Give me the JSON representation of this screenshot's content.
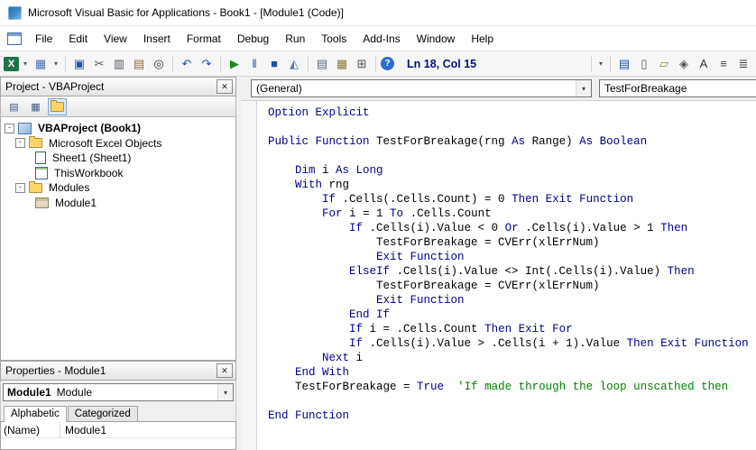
{
  "window": {
    "title": "Microsoft Visual Basic for Applications - Book1 - [Module1 (Code)]"
  },
  "icons": {
    "close": "✕",
    "dropdown": "▾"
  },
  "menu": {
    "items": [
      "File",
      "Edit",
      "View",
      "Insert",
      "Format",
      "Debug",
      "Run",
      "Tools",
      "Add-Ins",
      "Window",
      "Help"
    ]
  },
  "toolbar": {
    "items": [
      {
        "name": "view-microsoft-excel-icon",
        "glyph": "X",
        "style": "excel"
      },
      {
        "name": "view-excel-dropdown-icon",
        "glyph": "▾",
        "style": "arrow"
      },
      {
        "name": "insert-userform-icon",
        "glyph": "▦",
        "color": "#4a6fb5"
      },
      {
        "name": "insert-dropdown-icon",
        "glyph": "▾",
        "style": "arrow"
      },
      {
        "sep": true
      },
      {
        "name": "save-icon",
        "glyph": "▣",
        "color": "#2456a4"
      },
      {
        "name": "cut-icon",
        "glyph": "✂",
        "color": "#555555"
      },
      {
        "name": "copy-icon",
        "glyph": "▥",
        "color": "#556"
      },
      {
        "name": "paste-icon",
        "glyph": "▤",
        "color": "#8a6a3a"
      },
      {
        "name": "find-icon",
        "glyph": "◎",
        "color": "#333333"
      },
      {
        "sep": true
      },
      {
        "name": "undo-icon",
        "glyph": "↶",
        "color": "#1b4fae"
      },
      {
        "name": "redo-icon",
        "glyph": "↷",
        "color": "#1b4fae"
      },
      {
        "sep": true
      },
      {
        "name": "run-icon",
        "glyph": "▶",
        "color": "#1e8a1e"
      },
      {
        "name": "break-icon",
        "glyph": "‖",
        "color": "#1b4fae"
      },
      {
        "name": "reset-icon",
        "glyph": "■",
        "color": "#1b4fae"
      },
      {
        "name": "design-mode-icon",
        "glyph": "◭",
        "color": "#4a7ab5"
      },
      {
        "sep": true
      },
      {
        "name": "project-explorer-icon",
        "glyph": "▤",
        "color": "#5a6a8a"
      },
      {
        "name": "properties-window-icon",
        "glyph": "▦",
        "color": "#8a7a3a"
      },
      {
        "name": "object-browser-icon",
        "glyph": "⊞",
        "color": "#555555"
      },
      {
        "sep": true
      },
      {
        "name": "help-icon",
        "glyph": "?",
        "style": "help"
      },
      {
        "name": "cursor-position",
        "text": "Ln 18, Col 15"
      },
      {
        "spacer": true
      },
      {
        "sep": true
      },
      {
        "name": "toolbar-options-icon",
        "glyph": "▾",
        "style": "arrow"
      },
      {
        "sep": true
      },
      {
        "name": "list-properties-icon",
        "glyph": "▤",
        "color": "#1b4fae"
      },
      {
        "name": "list-constants-icon",
        "glyph": "▯",
        "color": "#555555"
      },
      {
        "name": "quick-info-icon",
        "glyph": "▱",
        "color": "#8a8a33"
      },
      {
        "name": "parameter-info-icon",
        "glyph": "◈",
        "color": "#555555"
      },
      {
        "name": "complete-word-icon",
        "glyph": "A",
        "color": "#333333"
      },
      {
        "name": "indent-icon",
        "glyph": "≡",
        "color": "#444444"
      },
      {
        "name": "outdent-icon",
        "glyph": "≣",
        "color": "#444444"
      }
    ]
  },
  "project_panel": {
    "title": "Project - VBAProject",
    "toolbar": [
      {
        "name": "view-code-icon",
        "glyph": "▤"
      },
      {
        "name": "view-object-icon",
        "glyph": "▦"
      },
      {
        "name": "toggle-folders-icon",
        "folder": true,
        "pressed": true
      }
    ],
    "tree": [
      {
        "label": "VBAProject (Book1)",
        "icon": "project",
        "level": 0,
        "expander": "-",
        "bold": true
      },
      {
        "label": "Microsoft Excel Objects",
        "icon": "folder",
        "level": 1,
        "expander": "-"
      },
      {
        "label": "Sheet1 (Sheet1)",
        "icon": "sheet",
        "level": 2
      },
      {
        "label": "ThisWorkbook",
        "icon": "workbook",
        "level": 2
      },
      {
        "label": "Modules",
        "icon": "folder",
        "level": 1,
        "expander": "-"
      },
      {
        "label": "Module1",
        "icon": "module",
        "level": 2
      }
    ]
  },
  "properties_panel": {
    "title": "Properties - Module1",
    "object_selector": {
      "name_part": "Module1",
      "type_part": "Module"
    },
    "tabs": [
      {
        "label": "Alphabetic",
        "active": true
      },
      {
        "label": "Categorized",
        "active": false
      }
    ],
    "rows": [
      {
        "property": "(Name)",
        "value": "Module1"
      }
    ]
  },
  "code_window": {
    "object_dropdown": "(General)",
    "procedure_dropdown": "TestForBreakage",
    "syntax_colors": {
      "keyword": "#00008b",
      "normal": "#000000",
      "comment": "#008000"
    },
    "lines": [
      [
        {
          "t": "Option Explicit",
          "c": "k"
        }
      ],
      [],
      [
        {
          "t": "Public Function ",
          "c": "k"
        },
        {
          "t": "TestForBreakage(rng ",
          "c": "n"
        },
        {
          "t": "As ",
          "c": "k"
        },
        {
          "t": "Range) ",
          "c": "n"
        },
        {
          "t": "As Boolean",
          "c": "k"
        }
      ],
      [],
      [
        {
          "t": "    ",
          "c": "n"
        },
        {
          "t": "Dim ",
          "c": "k"
        },
        {
          "t": "i ",
          "c": "n"
        },
        {
          "t": "As Long",
          "c": "k"
        }
      ],
      [
        {
          "t": "    ",
          "c": "n"
        },
        {
          "t": "With ",
          "c": "k"
        },
        {
          "t": "rng",
          "c": "n"
        }
      ],
      [
        {
          "t": "        ",
          "c": "n"
        },
        {
          "t": "If ",
          "c": "k"
        },
        {
          "t": ".Cells(.Cells.Count) = 0 ",
          "c": "n"
        },
        {
          "t": "Then Exit Function",
          "c": "k"
        }
      ],
      [
        {
          "t": "        ",
          "c": "n"
        },
        {
          "t": "For ",
          "c": "k"
        },
        {
          "t": "i = 1 ",
          "c": "n"
        },
        {
          "t": "To ",
          "c": "k"
        },
        {
          "t": ".Cells.Count",
          "c": "n"
        }
      ],
      [
        {
          "t": "            ",
          "c": "n"
        },
        {
          "t": "If ",
          "c": "k"
        },
        {
          "t": ".Cells(i).Value < 0 ",
          "c": "n"
        },
        {
          "t": "Or ",
          "c": "k"
        },
        {
          "t": ".Cells(i).Value > 1 ",
          "c": "n"
        },
        {
          "t": "Then",
          "c": "k"
        }
      ],
      [
        {
          "t": "                TestForBreakage = CVErr(xlErrNum)",
          "c": "n"
        }
      ],
      [
        {
          "t": "                ",
          "c": "n"
        },
        {
          "t": "Exit Function",
          "c": "k"
        }
      ],
      [
        {
          "t": "            ",
          "c": "n"
        },
        {
          "t": "ElseIf ",
          "c": "k"
        },
        {
          "t": ".Cells(i).Value <> Int(.Cells(i).Value) ",
          "c": "n"
        },
        {
          "t": "Then",
          "c": "k"
        }
      ],
      [
        {
          "t": "                TestForBreakage = CVErr(xlErrNum)",
          "c": "n"
        }
      ],
      [
        {
          "t": "                ",
          "c": "n"
        },
        {
          "t": "Exit Function",
          "c": "k"
        }
      ],
      [
        {
          "t": "            ",
          "c": "n"
        },
        {
          "t": "End If",
          "c": "k"
        }
      ],
      [
        {
          "t": "            ",
          "c": "n"
        },
        {
          "t": "If ",
          "c": "k"
        },
        {
          "t": "i = .Cells.Count ",
          "c": "n"
        },
        {
          "t": "Then Exit For",
          "c": "k"
        }
      ],
      [
        {
          "t": "            ",
          "c": "n"
        },
        {
          "t": "If ",
          "c": "k"
        },
        {
          "t": ".Cells(i).Value > .Cells(i + 1).Value ",
          "c": "n"
        },
        {
          "t": "Then Exit Function",
          "c": "k"
        }
      ],
      [
        {
          "t": "        ",
          "c": "n"
        },
        {
          "t": "Next ",
          "c": "k"
        },
        {
          "t": "i",
          "c": "n"
        }
      ],
      [
        {
          "t": "    ",
          "c": "n"
        },
        {
          "t": "End With",
          "c": "k"
        }
      ],
      [
        {
          "t": "    TestForBreakage = ",
          "c": "n"
        },
        {
          "t": "True",
          "c": "k"
        },
        {
          "t": "  ",
          "c": "n"
        },
        {
          "t": "'If made through the loop unscathed then",
          "c": "c"
        }
      ],
      [],
      [
        {
          "t": "End Function",
          "c": "k"
        }
      ]
    ]
  }
}
